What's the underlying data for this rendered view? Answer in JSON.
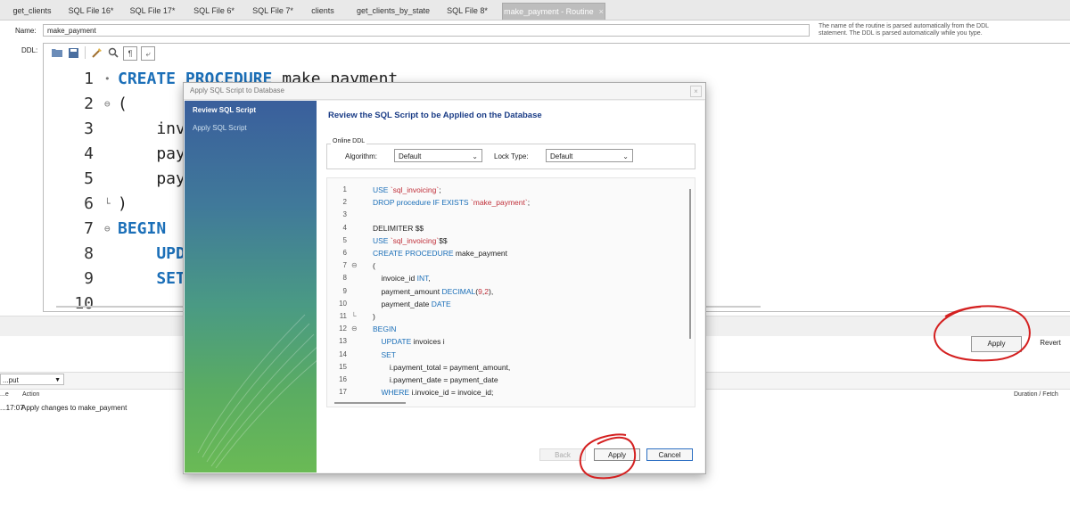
{
  "tabs": [
    {
      "label": "get_clients",
      "active": false
    },
    {
      "label": "SQL File 16*",
      "active": false
    },
    {
      "label": "SQL File 17*",
      "active": false
    },
    {
      "label": "SQL File 6*",
      "active": false
    },
    {
      "label": "SQL File 7*",
      "active": false
    },
    {
      "label": "clients",
      "active": false
    },
    {
      "label": "get_clients_by_state",
      "active": false
    },
    {
      "label": "SQL File 8*",
      "active": false
    },
    {
      "label": "make_payment - Routine",
      "active": true
    }
  ],
  "tab_close": "×",
  "routine": {
    "name_label": "Name:",
    "name_value": "make_payment",
    "help_text": "The name of the routine is parsed automatically from the DDL statement. The DDL is parsed automatically while you type.",
    "ddl_label": "DDL:"
  },
  "ddl_toolbar": [
    "folder-icon",
    "save-icon",
    "beautify-icon",
    "find-icon",
    "invisible-chars-icon",
    "wrap-icon"
  ],
  "ddl_lines": [
    {
      "num": "1",
      "fold": "•",
      "parts": [
        {
          "t": "CREATE PROCEDURE",
          "c": "kw"
        },
        {
          "t": " make_payment",
          "c": ""
        }
      ]
    },
    {
      "num": "2",
      "fold": "⊖",
      "parts": [
        {
          "t": "(",
          "c": ""
        }
      ]
    },
    {
      "num": "3",
      "fold": "",
      "parts": [
        {
          "t": "    inv",
          "c": ""
        }
      ]
    },
    {
      "num": "4",
      "fold": "",
      "parts": [
        {
          "t": "    pay",
          "c": ""
        }
      ]
    },
    {
      "num": "5",
      "fold": "",
      "parts": [
        {
          "t": "    pay",
          "c": ""
        }
      ]
    },
    {
      "num": "6",
      "fold": "└",
      "parts": [
        {
          "t": ")",
          "c": ""
        }
      ]
    },
    {
      "num": "7",
      "fold": "⊖",
      "parts": [
        {
          "t": "BEGIN",
          "c": "kw"
        }
      ]
    },
    {
      "num": "8",
      "fold": "",
      "parts": [
        {
          "t": "    UPD",
          "c": "kw"
        }
      ]
    },
    {
      "num": "9",
      "fold": "",
      "parts": [
        {
          "t": "    SET",
          "c": "kw"
        }
      ]
    },
    {
      "num": "10",
      "fold": "",
      "parts": [
        {
          "t": "",
          "c": ""
        }
      ]
    }
  ],
  "main_buttons": {
    "apply": "Apply",
    "revert": "Revert"
  },
  "output": {
    "selector": "...put",
    "columns": [
      "...e",
      "Action",
      "Duration / Fetch"
    ],
    "rows": [
      {
        "time": "...17:07",
        "action": "Apply changes to make_payment"
      }
    ]
  },
  "dialog": {
    "title": "Apply SQL Script to Database",
    "close": "×",
    "steps": [
      {
        "label": "Review SQL Script",
        "active": true
      },
      {
        "label": "Apply SQL Script",
        "active": false
      }
    ],
    "heading": "Review the SQL Script to be Applied on the Database",
    "online_ddl": {
      "legend": "Online DDL",
      "algorithm_label": "Algorithm:",
      "algorithm_value": "Default",
      "lock_label": "Lock Type:",
      "lock_value": "Default"
    },
    "script_lines": [
      {
        "num": "1",
        "fold": "",
        "parts": [
          {
            "t": "USE ",
            "c": "skw"
          },
          {
            "t": "`sql_invoicing`",
            "c": "sstr"
          },
          {
            "t": ";",
            "c": ""
          }
        ]
      },
      {
        "num": "2",
        "fold": "",
        "parts": [
          {
            "t": "DROP procedure IF EXISTS ",
            "c": "skw"
          },
          {
            "t": "`make_payment`",
            "c": "sstr"
          },
          {
            "t": ";",
            "c": ""
          }
        ]
      },
      {
        "num": "3",
        "fold": "",
        "parts": []
      },
      {
        "num": "4",
        "fold": "",
        "parts": [
          {
            "t": "DELIMITER $$",
            "c": ""
          }
        ]
      },
      {
        "num": "5",
        "fold": "",
        "parts": [
          {
            "t": "USE ",
            "c": "skw"
          },
          {
            "t": "`sql_invoicing`",
            "c": "sstr"
          },
          {
            "t": "$$",
            "c": ""
          }
        ]
      },
      {
        "num": "6",
        "fold": "",
        "parts": [
          {
            "t": "CREATE PROCEDURE ",
            "c": "skw"
          },
          {
            "t": "make_payment",
            "c": ""
          }
        ]
      },
      {
        "num": "7",
        "fold": "⊖",
        "parts": [
          {
            "t": "(",
            "c": ""
          }
        ]
      },
      {
        "num": "8",
        "fold": "",
        "parts": [
          {
            "t": "    invoice_id ",
            "c": ""
          },
          {
            "t": "INT",
            "c": "skw"
          },
          {
            "t": ",",
            "c": ""
          }
        ]
      },
      {
        "num": "9",
        "fold": "",
        "parts": [
          {
            "t": "    payment_amount ",
            "c": ""
          },
          {
            "t": "DECIMAL",
            "c": "skw"
          },
          {
            "t": "(",
            "c": ""
          },
          {
            "t": "9",
            "c": "snum2"
          },
          {
            "t": ",",
            "c": ""
          },
          {
            "t": "2",
            "c": "snum2"
          },
          {
            "t": "),",
            "c": ""
          }
        ]
      },
      {
        "num": "10",
        "fold": "",
        "parts": [
          {
            "t": "    payment_date ",
            "c": ""
          },
          {
            "t": "DATE",
            "c": "skw"
          }
        ]
      },
      {
        "num": "11",
        "fold": "└",
        "parts": [
          {
            "t": ")",
            "c": ""
          }
        ]
      },
      {
        "num": "12",
        "fold": "⊖",
        "parts": [
          {
            "t": "BEGIN",
            "c": "skw"
          }
        ]
      },
      {
        "num": "13",
        "fold": "",
        "parts": [
          {
            "t": "    UPDATE ",
            "c": "skw"
          },
          {
            "t": "invoices i",
            "c": ""
          }
        ]
      },
      {
        "num": "14",
        "fold": "",
        "parts": [
          {
            "t": "    SET",
            "c": "skw"
          }
        ]
      },
      {
        "num": "15",
        "fold": "",
        "parts": [
          {
            "t": "        i.payment_total = payment_amount,",
            "c": ""
          }
        ]
      },
      {
        "num": "16",
        "fold": "",
        "parts": [
          {
            "t": "        i.payment_date = payment_date",
            "c": ""
          }
        ]
      },
      {
        "num": "17",
        "fold": "",
        "parts": [
          {
            "t": "    WHERE ",
            "c": "skw"
          },
          {
            "t": "i.invoice_id = invoice_id;",
            "c": ""
          }
        ]
      }
    ],
    "buttons": {
      "back": "Back",
      "apply": "Apply",
      "cancel": "Cancel"
    }
  },
  "colors": {
    "accent": "#1b6fb8",
    "title_blue": "#1a3c86",
    "annotation": "#d42020"
  }
}
